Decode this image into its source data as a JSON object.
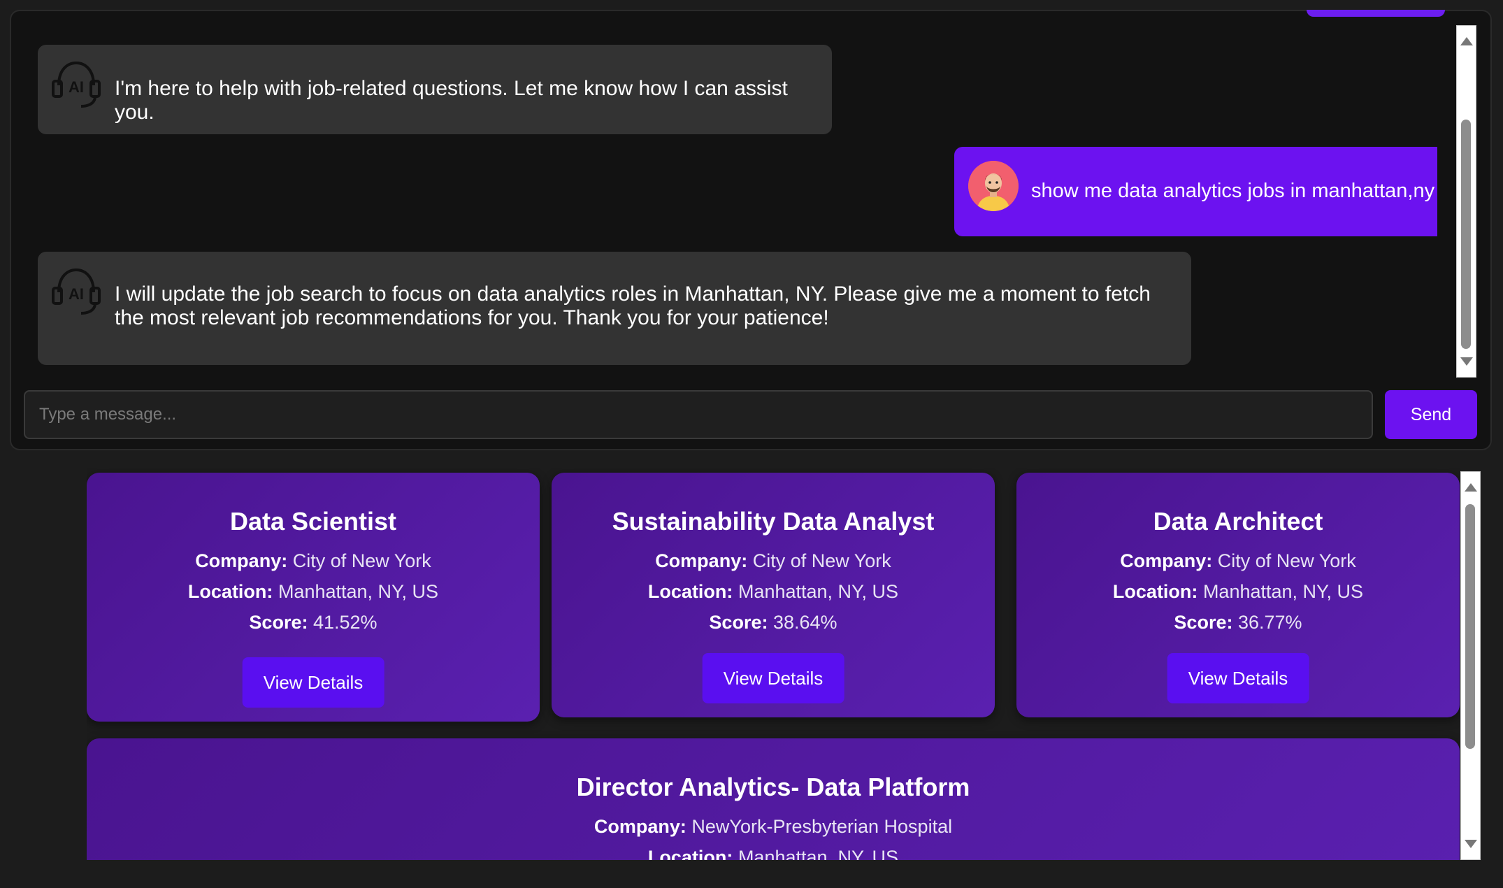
{
  "chat": {
    "messages": [
      {
        "role": "bot",
        "avatar_icon": "ai-headset-icon",
        "text": "I'm here to help with job-related questions. Let me know how I can assist you."
      },
      {
        "role": "user",
        "avatar_icon": "user-avatar",
        "text": "show me data analytics jobs in manhattan,ny"
      },
      {
        "role": "bot",
        "avatar_icon": "ai-headset-icon",
        "text": "I will update the job search to focus on data analytics roles in Manhattan, NY. Please give me a moment to fetch the most relevant job recommendations for you. Thank you for your patience!"
      }
    ],
    "input": {
      "placeholder": "Type a message...",
      "value": ""
    },
    "send_label": "Send"
  },
  "jobs": [
    {
      "title": "Data Scientist",
      "company_label": "Company:",
      "company": "City of New York",
      "location_label": "Location:",
      "location": "Manhattan, NY, US",
      "score_label": "Score:",
      "score": "41.52%",
      "button": "View Details"
    },
    {
      "title": "Sustainability Data Analyst",
      "company_label": "Company:",
      "company": "City of New York",
      "location_label": "Location:",
      "location": "Manhattan, NY, US",
      "score_label": "Score:",
      "score": "38.64%",
      "button": "View Details"
    },
    {
      "title": "Data Architect",
      "company_label": "Company:",
      "company": "City of New York",
      "location_label": "Location:",
      "location": "Manhattan, NY, US",
      "score_label": "Score:",
      "score": "36.77%",
      "button": "View Details"
    },
    {
      "title": "Director Analytics- Data Platform",
      "company_label": "Company:",
      "company": "NewYork-Presbyterian Hospital",
      "location_label": "Location:",
      "location": "Manhattan, NY, US"
    }
  ],
  "colors": {
    "accent": "#6c12f0",
    "bot_bubble": "#333333",
    "card_gradient_start": "#4a1490",
    "card_gradient_end": "#5a20b0",
    "background": "#121212"
  }
}
